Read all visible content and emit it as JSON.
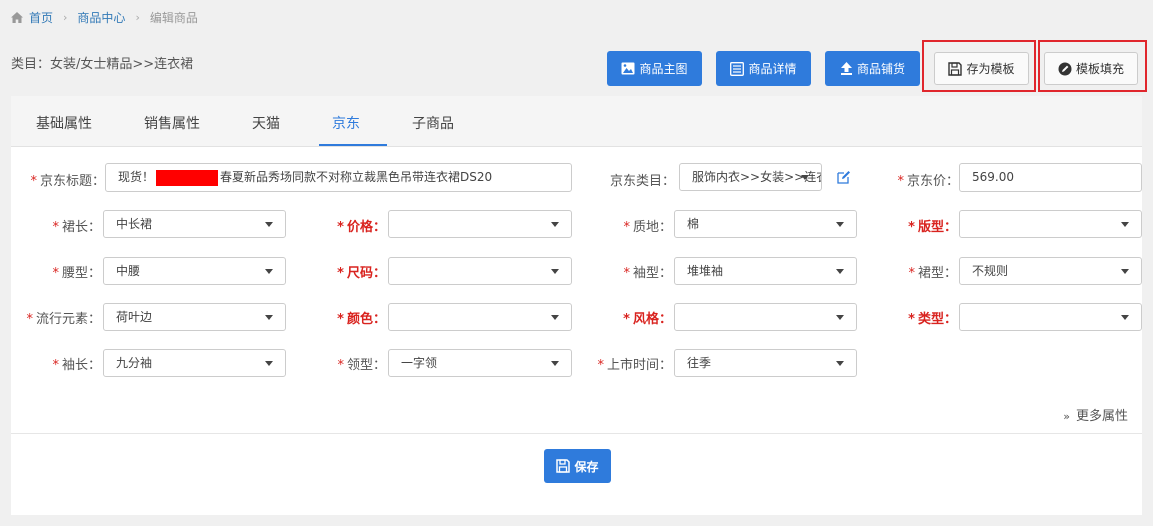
{
  "breadcrumb": {
    "home": "首页",
    "center": "商品中心",
    "current": "编辑商品"
  },
  "category_line": "类目：女装/女士精品>>连衣裙",
  "toolbar": {
    "main_image": "商品主图",
    "detail": "商品详情",
    "listing": "商品铺货",
    "save_template": "存为模板",
    "fill_template": "模板填充"
  },
  "tabs": [
    "基础属性",
    "销售属性",
    "天猫",
    "京东",
    "子商品"
  ],
  "active_tab": "京东",
  "form": {
    "title": {
      "label": "京东标题：",
      "prefix": "现货！",
      "suffix": "春夏新品秀场同款不对称立裁黑色吊带连衣裙DS20"
    },
    "category": {
      "label": "京东类目：",
      "value": "服饰内衣>>女装>>连衣裙"
    },
    "price": {
      "label": "京东价：",
      "value": "569.00"
    },
    "skirt_length": {
      "label": "裙长：",
      "value": "中长裙"
    },
    "price_attr": {
      "label": "价格：",
      "value": ""
    },
    "material": {
      "label": "质地：",
      "value": "棉"
    },
    "fit": {
      "label": "版型：",
      "value": ""
    },
    "waist": {
      "label": "腰型：",
      "value": "中腰"
    },
    "size": {
      "label": "尺码：",
      "value": ""
    },
    "sleeve_type": {
      "label": "袖型：",
      "value": "堆堆袖"
    },
    "skirt_type": {
      "label": "裙型：",
      "value": "不规则"
    },
    "trend": {
      "label": "流行元素：",
      "value": "荷叶边"
    },
    "color": {
      "label": "颜色：",
      "value": ""
    },
    "style": {
      "label": "风格：",
      "value": ""
    },
    "type": {
      "label": "类型：",
      "value": ""
    },
    "sleeve_length": {
      "label": "袖长：",
      "value": "九分袖"
    },
    "collar": {
      "label": "领型：",
      "value": "一字领"
    },
    "launch_time": {
      "label": "上市时间：",
      "value": "往季"
    }
  },
  "more_attributes": "更多属性",
  "save_button": "保存",
  "colors": {
    "primary": "#2f7bdc",
    "required": "#d9231f",
    "highlight": "#e0262c"
  }
}
